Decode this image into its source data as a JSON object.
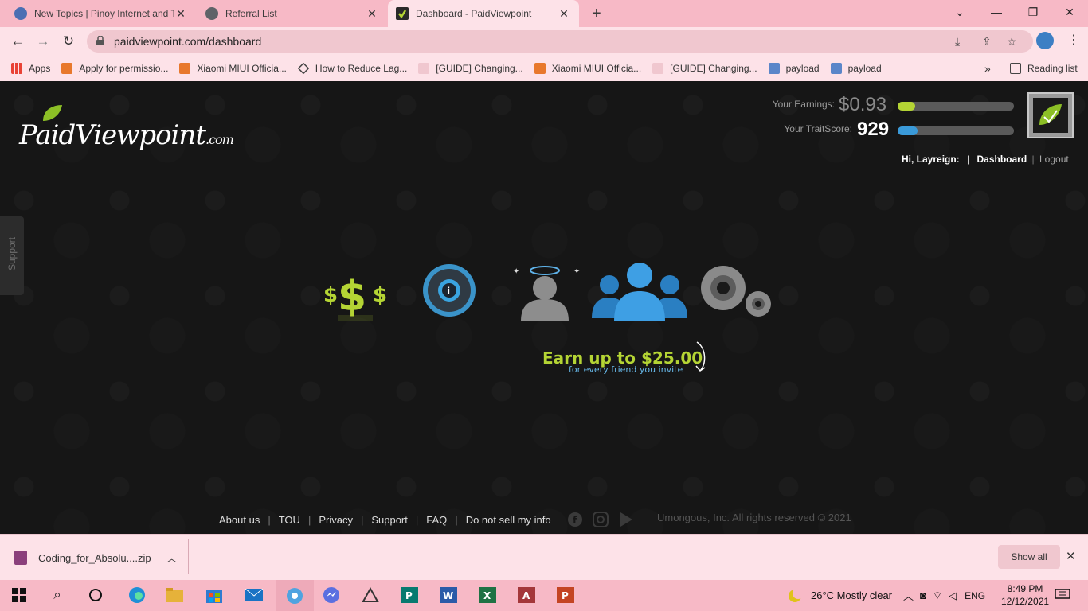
{
  "browser": {
    "tabs": [
      {
        "title": "New Topics | Pinoy Internet and T",
        "active": false
      },
      {
        "title": "Referral List",
        "active": false
      },
      {
        "title": "Dashboard - PaidViewpoint",
        "active": true
      }
    ],
    "new_tab_label": "+",
    "url": "paidviewpoint.com/dashboard",
    "bookmarks": [
      "Apps",
      "Apply for permissio...",
      "Xiaomi MIUI Officia...",
      "How to Reduce Lag...",
      "[GUIDE] Changing...",
      "Xiaomi MIUI Officia...",
      "[GUIDE] Changing...",
      "payload",
      "payload"
    ],
    "bookmarks_overflow": "»",
    "reading_list": "Reading list"
  },
  "site": {
    "logo_text": "PaidViewpoint",
    "logo_domain": ".com",
    "earnings_label": "Your Earnings:",
    "earnings_value": "$0.93",
    "earnings_progress": 0.15,
    "traitscore_label": "Your TraitScore:",
    "traitscore_value": "929",
    "traitscore_progress": 0.17,
    "greeting": "Hi, Layreign:",
    "nav_separator": "|",
    "dashboard_link": "Dashboard",
    "logout_link": "Logout",
    "support_tab": "Support",
    "promo_line1": "Earn up to $25.00",
    "promo_line2": "for every friend you invite",
    "footer_links": [
      "About us",
      "TOU",
      "Privacy",
      "Support",
      "FAQ",
      "Do not sell my info"
    ],
    "footer_separator": "|",
    "copyright": "Umongous, Inc. All rights reserved © 2021",
    "colors": {
      "accent_green": "#b4d434",
      "accent_blue": "#4aa8e0"
    }
  },
  "download_bar": {
    "file_name": "Coding_for_Absolu....zip",
    "show_all": "Show all"
  },
  "taskbar": {
    "weather": "26°C  Mostly clear",
    "language": "ENG",
    "time": "8:49 PM",
    "date": "12/12/2021"
  }
}
